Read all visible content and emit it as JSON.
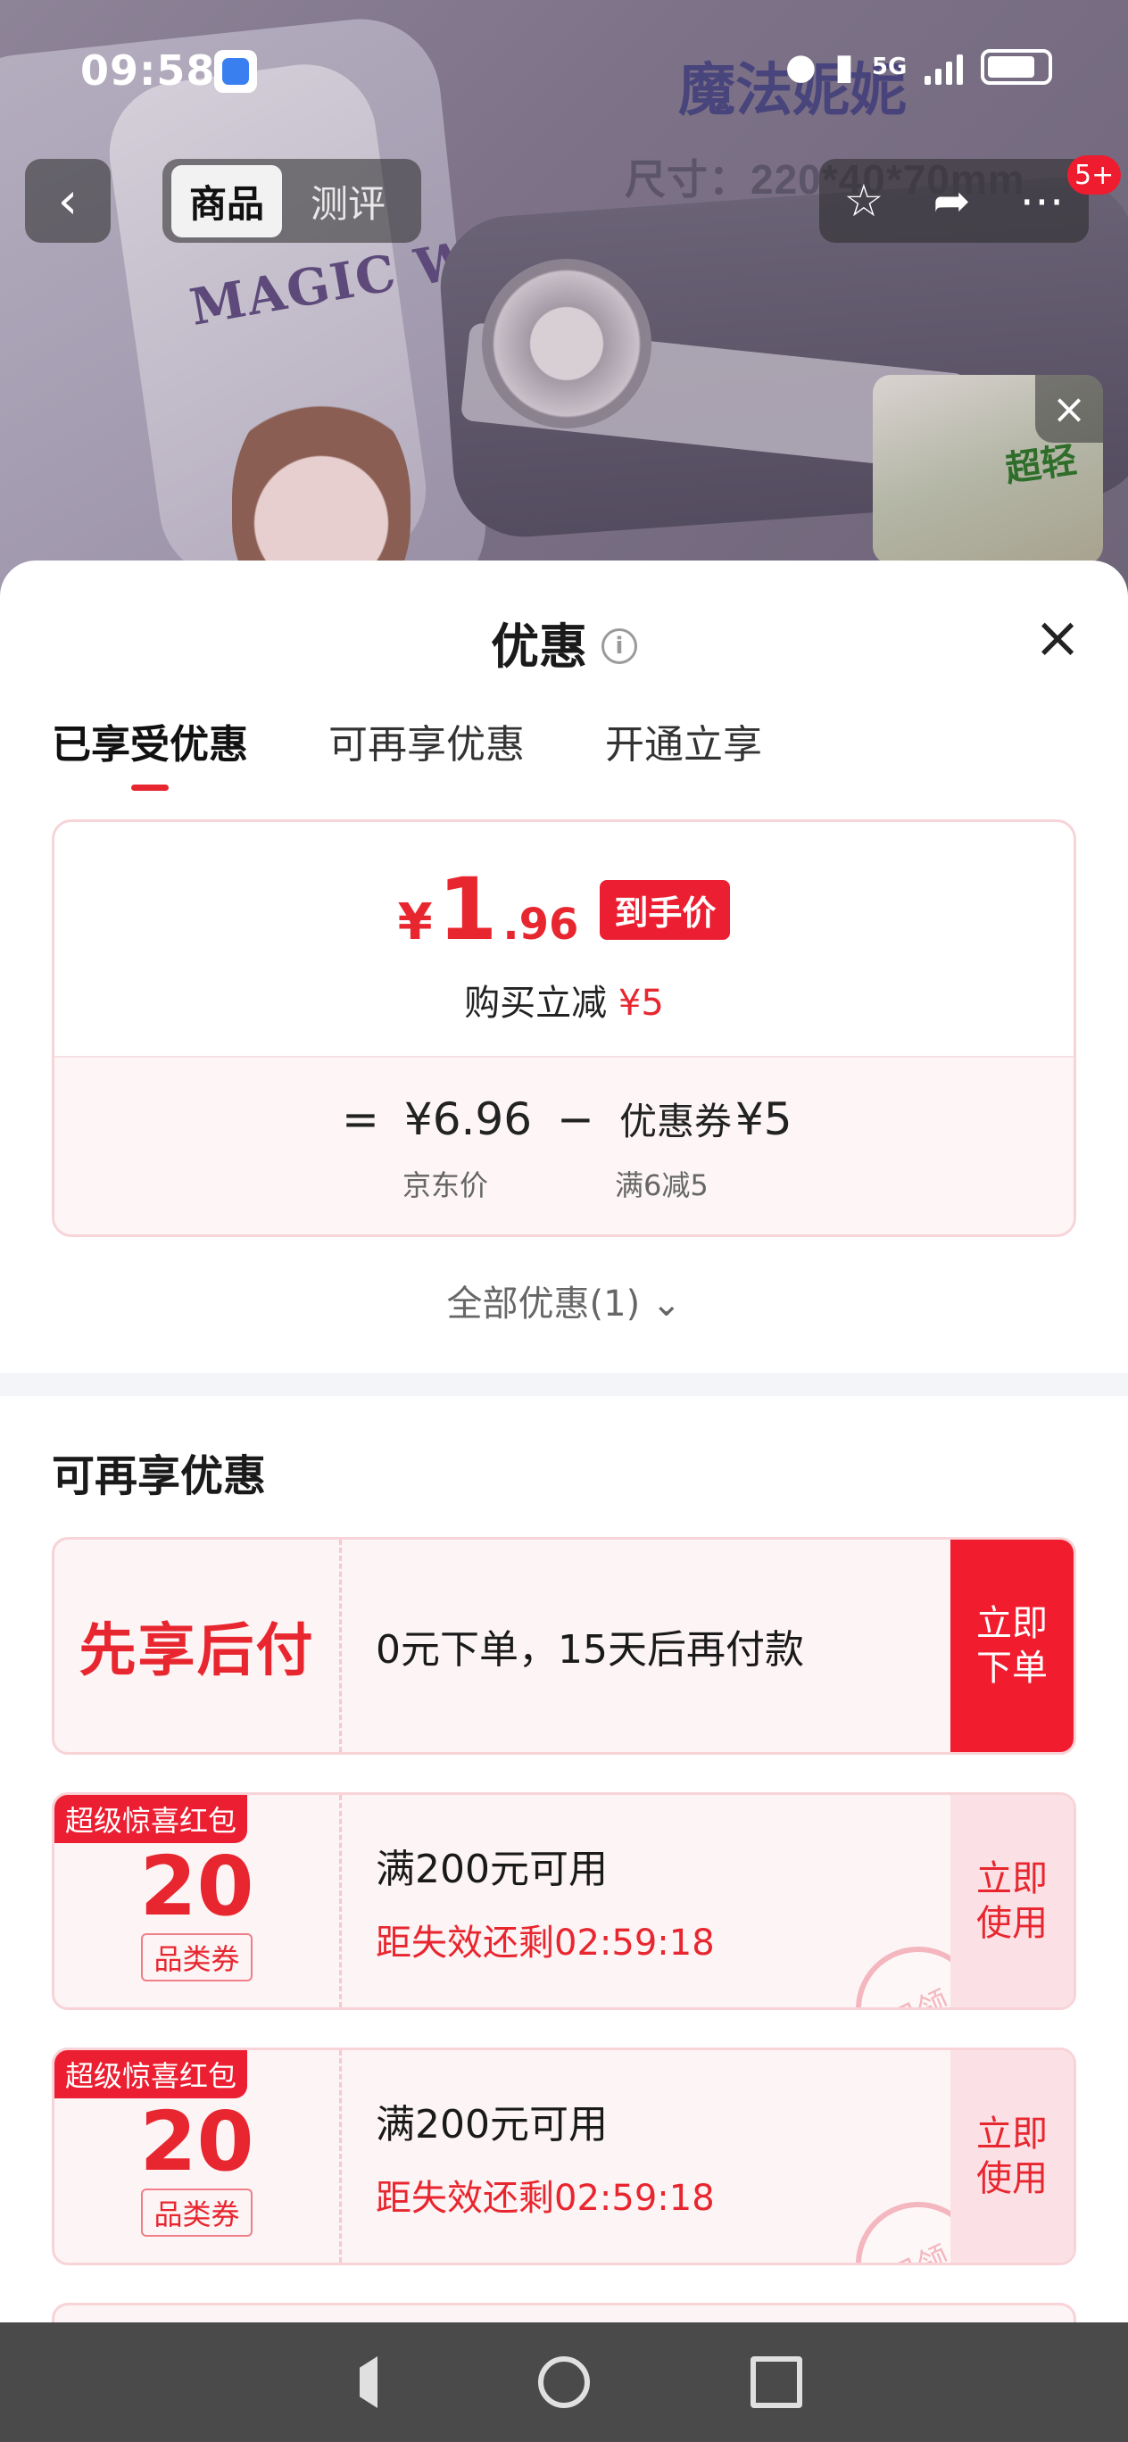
{
  "status_bar": {
    "time": "09:58",
    "network": "5G",
    "icons": [
      "location-icon",
      "vibrate-icon",
      "signal-icon",
      "battery-icon"
    ]
  },
  "background": {
    "brand_text": "魔法妮妮",
    "size_text": "尺寸：220*40*70mm",
    "case_text": "MAGIC WORLD",
    "thumb_text": "超轻"
  },
  "top_nav": {
    "tabs": [
      "商品",
      "测评"
    ],
    "active_tab": "商品",
    "badge": "5+"
  },
  "sheet": {
    "title": "优惠",
    "tabs": [
      "已享受优惠",
      "可再享优惠",
      "开通立享"
    ],
    "active_tab": "已享受优惠",
    "price": {
      "yen": "¥",
      "integer": "1",
      "decimal": ".96",
      "tag": "到手价",
      "reduce_label": "购买立减",
      "reduce_amount": "¥5"
    },
    "calc": {
      "equals": "=",
      "jd_price": "¥6.96",
      "minus": "−",
      "coupon_label": "优惠券",
      "coupon_amount": "¥5",
      "jd_price_caption": "京东价",
      "coupon_caption": "满6减5"
    },
    "all_offers": "全部优惠(1)",
    "section_title": "可再享优惠",
    "pay_later": {
      "title": "先享后付",
      "desc": "0元下单，15天后再付款",
      "button": "立即\n下单"
    },
    "coupons": [
      {
        "ribbon": "超级惊喜红包",
        "amount": "20",
        "category": "品类券",
        "condition": "满200元可用",
        "timer": "距失效还剩02:59:18",
        "button": "立即\n使用",
        "stamp": "已领"
      },
      {
        "ribbon": "超级惊喜红包",
        "amount": "20",
        "category": "品类券",
        "condition": "满200元可用",
        "timer": "距失效还剩02:59:18",
        "button": "立即\n使用",
        "stamp": "已领"
      }
    ]
  },
  "colors": {
    "accent_red": "#e8262f",
    "button_red": "#f21c2f",
    "card_border": "#f7d4d8",
    "nav_bar": "#4a4a4a"
  }
}
